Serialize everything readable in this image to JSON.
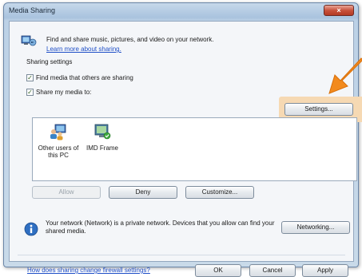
{
  "window": {
    "title": "Media Sharing",
    "close_glyph": "×"
  },
  "header": {
    "description": "Find and share music, pictures, and video on your network.",
    "learn_link": "Learn more about sharing."
  },
  "sharing": {
    "section_label": "Sharing settings",
    "find_media": {
      "label": "Find media that others are sharing",
      "checked": true
    },
    "share_my_media": {
      "label": "Share my media to:",
      "checked": true
    },
    "settings_button": "Settings..."
  },
  "devices": [
    {
      "label_line1": "Other users of",
      "label_line2": "this PC",
      "icon": "users-computer-icon"
    },
    {
      "label_line1": "IMD Frame",
      "label_line2": "",
      "icon": "media-frame-icon"
    }
  ],
  "device_actions": {
    "allow": "Allow",
    "deny": "Deny",
    "customize": "Customize..."
  },
  "network": {
    "info_text": "Your network (Network) is a private network. Devices that you allow can find your shared media.",
    "networking_button": "Networking..."
  },
  "footer": {
    "firewall_link": "How does sharing change firewall settings?",
    "ok": "OK",
    "cancel": "Cancel",
    "apply": "Apply"
  },
  "colors": {
    "link": "#1f4fc7",
    "highlight": "#f6d9b3",
    "arrow": "#f28a1e"
  }
}
